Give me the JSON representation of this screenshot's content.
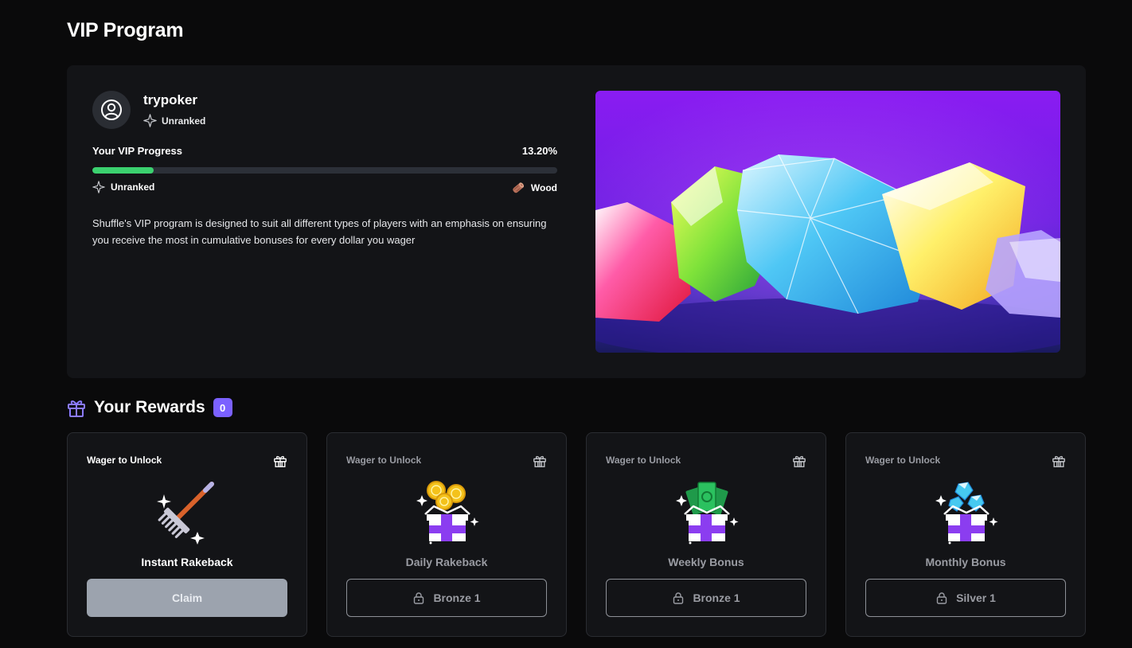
{
  "page": {
    "title": "VIP Program"
  },
  "profile": {
    "username": "trypoker",
    "rank": "Unranked"
  },
  "progress": {
    "label": "Your VIP Progress",
    "percent_text": "13.20%",
    "percent": 13.2,
    "current_tier": "Unranked",
    "next_tier": "Wood",
    "fill_color": "#3bd16f"
  },
  "description": "Shuffle's VIP program is designed to suit all different types of players with an emphasis on ensuring you receive the most in cumulative bonuses for every dollar you wager",
  "rewards": {
    "title": "Your Rewards",
    "count": "0",
    "accent": "#7b61ff",
    "cards": [
      {
        "status": "Wager to Unlock",
        "name": "Instant Rakeback",
        "action": "Claim",
        "icon": "rake-icon"
      },
      {
        "status": "Wager to Unlock",
        "name": "Daily Rakeback",
        "action": "Bronze 1",
        "icon": "gift-coins-icon"
      },
      {
        "status": "Wager to Unlock",
        "name": "Weekly Bonus",
        "action": "Bronze 1",
        "icon": "gift-cash-icon"
      },
      {
        "status": "Wager to Unlock",
        "name": "Monthly Bonus",
        "action": "Silver 1",
        "icon": "gift-diamonds-icon"
      }
    ]
  }
}
